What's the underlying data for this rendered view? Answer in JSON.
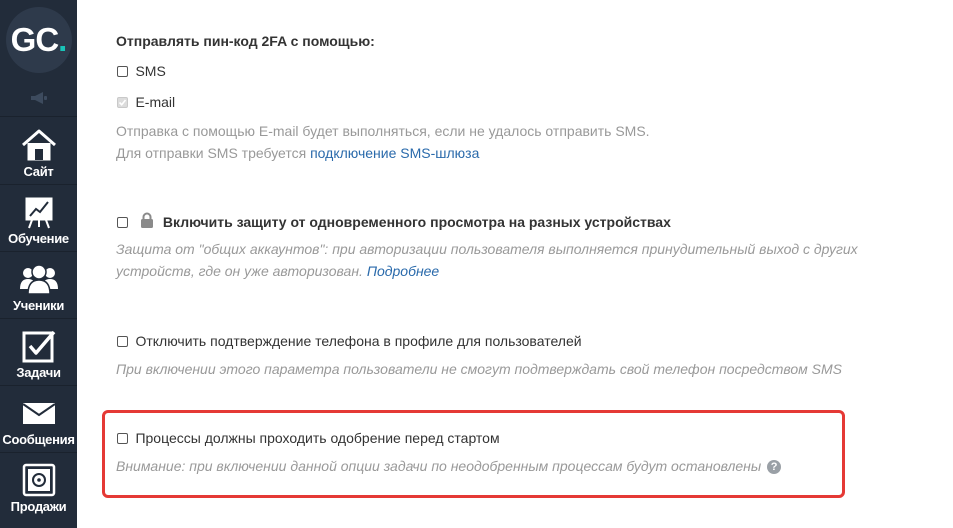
{
  "logo": {
    "text": "GC",
    "dot": "."
  },
  "sidebar": {
    "items": [
      {
        "id": "site",
        "label": "Сайт",
        "icon": "home-icon"
      },
      {
        "id": "learning",
        "label": "Обучение",
        "icon": "chart-board-icon"
      },
      {
        "id": "students",
        "label": "Ученики",
        "icon": "users-icon"
      },
      {
        "id": "tasks",
        "label": "Задачи",
        "icon": "checkbox-icon"
      },
      {
        "id": "messages",
        "label": "Сообщения",
        "icon": "envelope-icon"
      },
      {
        "id": "sales",
        "label": "Продажи",
        "icon": "safe-icon"
      }
    ]
  },
  "twofa": {
    "title": "Отправлять пин-код 2FA с помощью:",
    "sms_label": "SMS",
    "email_label": "E-mail",
    "note_line1": "Отправка с помощью E-mail будет выполняться, если не удалось отправить SMS.",
    "note_line2_prefix": "Для отправки SMS требуется ",
    "note_link": "подключение SMS-шлюза"
  },
  "multi_device": {
    "label": "Включить защиту от одновременного просмотра на разных устройствах",
    "desc_line1": "Защита от \"общих аккаунтов\": при авторизации пользователя выполняется принудительный выход с других",
    "desc_line2_prefix": "устройств, где он уже авторизован. ",
    "desc_link": "Подробнее"
  },
  "phone_confirm": {
    "label": "Отключить подтверждение телефона в профиле для пользователей",
    "desc": "При включении этого параметра пользователи не смогут подтверждать свой телефон посредством SMS"
  },
  "process_approval": {
    "label": "Процессы должны проходить одобрение перед стартом",
    "desc": "Внимание: при включении данной опции задачи по неодобренным процессам будут остановлены",
    "help": "?"
  },
  "colors": {
    "sidebar_bg": "#222c3a",
    "logo_accent": "#19c4b8",
    "link": "#2a6aab",
    "highlight": "#e53935",
    "muted_text": "#999999"
  }
}
